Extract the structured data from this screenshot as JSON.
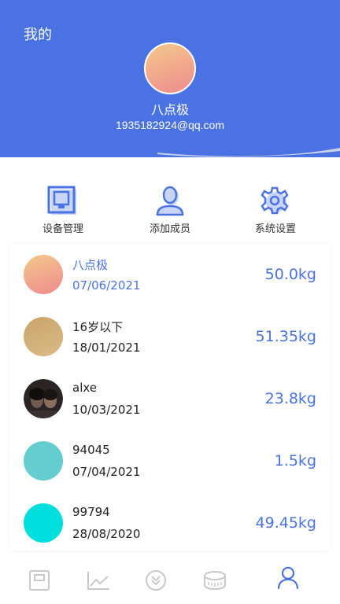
{
  "header": {
    "title": "我的",
    "profile_name": "八点极",
    "email": "1935182924@qq.com"
  },
  "actions": [
    {
      "label": "设备管理",
      "icon": "router-icon"
    },
    {
      "label": "添加成员",
      "icon": "add-member-icon"
    },
    {
      "label": "系统设置",
      "icon": "gear-icon"
    }
  ],
  "members": [
    {
      "name": "八点极",
      "date": "07/06/2021",
      "weight": "50.0kg",
      "avatar": "gradient-peach"
    },
    {
      "name": "16岁以下",
      "date": "18/01/2021",
      "weight": "51.35kg",
      "avatar": "tan"
    },
    {
      "name": "alxe",
      "date": "10/03/2021",
      "weight": "23.8kg",
      "avatar": "photo"
    },
    {
      "name": "94045",
      "date": "07/04/2021",
      "weight": "1.5kg",
      "avatar": "teal"
    },
    {
      "name": "99794",
      "date": "28/08/2020",
      "weight": "49.45kg",
      "avatar": "cyan"
    }
  ],
  "tabbar": [
    {
      "icon": "scale-icon",
      "active": false
    },
    {
      "icon": "trend-chart-icon",
      "active": false
    },
    {
      "icon": "double-chevron-down-icon",
      "active": false
    },
    {
      "icon": "tape-measure-icon",
      "active": false
    },
    {
      "icon": "profile-icon",
      "active": true
    }
  ],
  "colors": {
    "primary": "#4a72e3",
    "text": "#222222",
    "inactive_icon": "#c8c8c8"
  }
}
